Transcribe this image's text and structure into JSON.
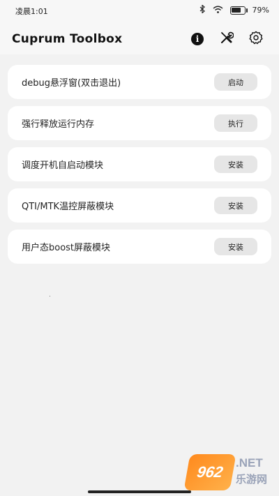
{
  "status": {
    "time": "凌晨1:01",
    "battery": "79%",
    "battery_level": 0.79,
    "icons": [
      "bluetooth-icon",
      "wifi-icon",
      "battery-icon"
    ]
  },
  "appbar": {
    "title": "Cuprum Toolbox",
    "icons": [
      "info-icon",
      "tools-icon",
      "settings-gear-icon"
    ]
  },
  "items": [
    {
      "label": "debug悬浮窗(双击退出)",
      "button": "启动"
    },
    {
      "label": "强行释放运行内存",
      "button": "执行"
    },
    {
      "label": "调度开机自启动模块",
      "button": "安装"
    },
    {
      "label": "QTI/MTK温控屏蔽模块",
      "button": "安装"
    },
    {
      "label": "用户态boost屏蔽模块",
      "button": "安装"
    }
  ],
  "watermark": {
    "logo": "962",
    "net": ".NET",
    "sub": "乐游网"
  }
}
